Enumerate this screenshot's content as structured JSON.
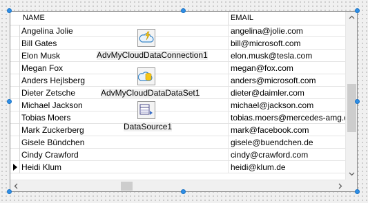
{
  "grid": {
    "columns": [
      "NAME",
      "EMAIL"
    ],
    "rows": [
      {
        "name": "Angelina Jolie",
        "email": "angelina@jolie.com"
      },
      {
        "name": "Bill Gates",
        "email": "bill@microsoft.com"
      },
      {
        "name": "Elon Musk",
        "email": "elon.musk@tesla.com"
      },
      {
        "name": "Megan Fox",
        "email": "megan@fox.com"
      },
      {
        "name": "Anders Hejlsberg",
        "email": "anders@microsoft.com"
      },
      {
        "name": "Dieter Zetsche",
        "email": "dieter@daimler.com"
      },
      {
        "name": "Michael Jackson",
        "email": "michael@jackson.com"
      },
      {
        "name": "Tobias Moers",
        "email": "tobias.moers@mercedes-amg.de"
      },
      {
        "name": "Mark Zuckerberg",
        "email": "mark@facebook.com"
      },
      {
        "name": "Gisele Bündchen",
        "email": "gisele@buendchen.de"
      },
      {
        "name": "Cindy Crawford",
        "email": "cindy@crawford.com"
      },
      {
        "name": "Heidi Klum",
        "email": "heidi@klum.de"
      }
    ],
    "current_row": 11
  },
  "components": [
    {
      "label": "AdvMyCloudDataConnection1",
      "icon": "cloud-connection-icon"
    },
    {
      "label": "AdvMyCloudDataDataSet1",
      "icon": "cloud-dataset-icon"
    },
    {
      "label": "DataSource1",
      "icon": "datasource-icon"
    }
  ],
  "colors": {
    "handle": "#2f8fe6",
    "selection_handle_border": "#1670c4"
  }
}
